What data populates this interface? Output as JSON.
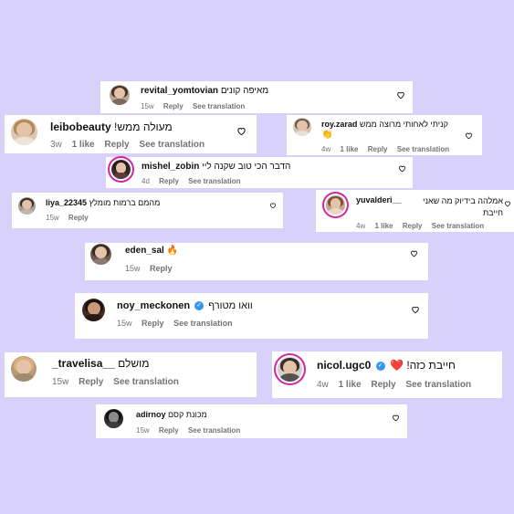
{
  "colors": {
    "background": "#d8d2fb",
    "card": "#ffffff",
    "meta": "#737373",
    "verified": "#3797f0",
    "story_ring": "#d6249f"
  },
  "icons": {
    "like": "heart-outline-icon",
    "verified": "verified-badge-icon"
  },
  "comments": [
    {
      "username": "revital_yomtovian",
      "text": "מאיפה קונים",
      "time": "15w",
      "likes": "",
      "reply": "Reply",
      "translate": "See translation"
    },
    {
      "username": "leibobeauty",
      "text": "מעולה ממש!",
      "time": "3w",
      "likes": "1 like",
      "reply": "Reply",
      "translate": "See translation"
    },
    {
      "username": "roy.zarad",
      "text": "קניתי לאחותי מרוצה ממש",
      "emoji": "👏",
      "time": "4w",
      "likes": "1 like",
      "reply": "Reply",
      "translate": "See translation"
    },
    {
      "username": "mishel_zobin",
      "text": "הדבר הכי טוב שקנה ליי",
      "time": "4d",
      "likes": "",
      "reply": "Reply",
      "translate": "See translation"
    },
    {
      "username": "liya_22345",
      "text": "מהמם ברמות מומלץ",
      "time": "15w",
      "likes": "",
      "reply": "Reply",
      "translate": ""
    },
    {
      "username": "yuvalderi__",
      "text": "אמלהה בידיוק מה שאני חייבת",
      "time": "4w",
      "likes": "1 like",
      "reply": "Reply",
      "translate": "See translation"
    },
    {
      "username": "eden_sal",
      "text": "",
      "emoji": "🔥",
      "time": "15w",
      "likes": "",
      "reply": "Reply",
      "translate": ""
    },
    {
      "username": "noy_meckonen",
      "text": "וואו מטורף",
      "verified": true,
      "time": "15w",
      "likes": "",
      "reply": "Reply",
      "translate": "See translation"
    },
    {
      "username": "_travelisa__",
      "text": "מושלם",
      "time": "15w",
      "likes": "",
      "reply": "Reply",
      "translate": "See translation"
    },
    {
      "username": "nicol.ugc0",
      "text": "חייבת כזה!",
      "emoji": "❤️",
      "verified": true,
      "time": "4w",
      "likes": "1 like",
      "reply": "Reply",
      "translate": "See translation"
    },
    {
      "username": "adirnoy",
      "text": "מכונת קסם",
      "time": "15w",
      "likes": "",
      "reply": "Reply",
      "translate": "See translation"
    }
  ]
}
